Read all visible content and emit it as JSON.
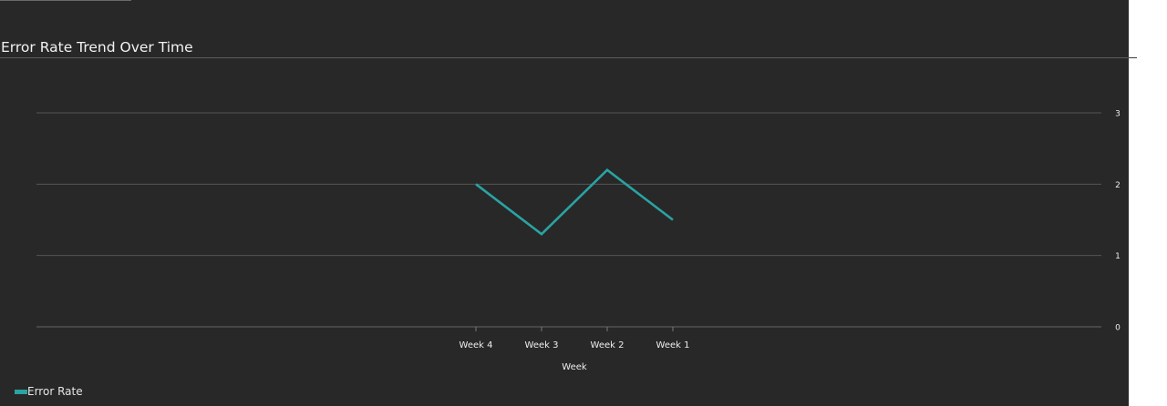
{
  "chart_data": {
    "type": "line",
    "title": "Error Rate Trend Over Time",
    "xlabel": "Week",
    "ylabel": "",
    "categories": [
      "Week 4",
      "Week 3",
      "Week 2",
      "Week 1"
    ],
    "series": [
      {
        "name": "Error Rate",
        "values": [
          2.0,
          1.3,
          2.2,
          1.5
        ],
        "color": "#2aa3a3"
      }
    ],
    "ylim": [
      0,
      3
    ],
    "yticks": [
      0,
      1,
      2,
      3
    ],
    "ytick_labels": [
      "0",
      "1",
      "2",
      "3"
    ],
    "y_axis_side": "right",
    "grid": true,
    "legend_position": "bottom-left"
  },
  "colors": {
    "background": "#282828",
    "grid": "#555555",
    "text": "#f2f2f2",
    "series": "#2aa3a3"
  }
}
